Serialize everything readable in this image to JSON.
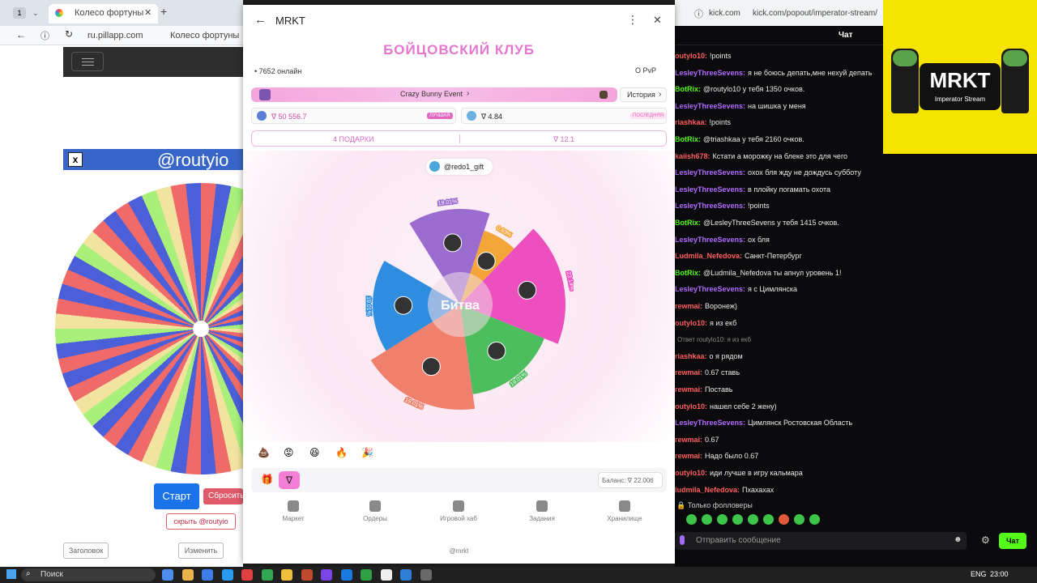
{
  "left_browser": {
    "tab_count": "1",
    "tab_title": "Колесо фортуны",
    "url": "ru.pillapp.com",
    "page_title": "Колесо фортуны",
    "wheel_header": "@routyio",
    "close_x": "x",
    "start_button": "Старт",
    "reset_button": "Сбросить",
    "hide_button": "скрыть @routyio",
    "heading_field": "Заголовок",
    "change_button": "Изменить"
  },
  "modal": {
    "back_icon": "arrow-left-icon",
    "app_name": "MRKT",
    "title": "БОЙЦОВСКИЙ КЛУБ",
    "online": "• 7652 онлайн",
    "pvp": "О PvP",
    "event": "Crazy Bunny Event",
    "history": "История",
    "best_value": "∇ 50 556.7",
    "best_badge": "ЛУЧШАЯ",
    "last_value": "∇ 4.84",
    "last_badge": "ПОСЛЕДНЯЯ",
    "gifts": "4 ПОДАРКИ",
    "pot": "∇ 12.1",
    "player": "@redo1_gift",
    "center": "Битва",
    "balance": "Баланс: ∇ 22.006",
    "footer": "@mrkt",
    "segments": [
      {
        "label": "19.01%",
        "color": "#9b6cd0"
      },
      {
        "label": "0.63%",
        "color": "#f3a637"
      },
      {
        "label": "23.14%",
        "color": "#ee4fbf"
      },
      {
        "label": "19.01%",
        "color": "#4cbe5d"
      },
      {
        "label": "19.01%",
        "color": "#f0806c"
      },
      {
        "label": "19.01%",
        "color": "#2f8de0"
      }
    ],
    "nav": [
      "Маркет",
      "Ордеры",
      "Игровой хаб",
      "Задания",
      "Хранилище"
    ]
  },
  "chat": {
    "url_host": "kick.com",
    "url_path": "kick.com/popout/imperator-stream/",
    "header": "Чат",
    "brand_logo": "MRKT",
    "brand_sub": "Imperator Stream",
    "followers_only": "Только фолловеры",
    "input_placeholder": "Отправить сообщение",
    "send": "Чат",
    "messages": [
      {
        "user": "outylo10:",
        "text": "!points",
        "color": "#ff5f5f"
      },
      {
        "user": "LesleyThreeSevens:",
        "text": "я не боюсь депать,мне нехуй депать",
        "color": "#b26bff"
      },
      {
        "user": "BotRix:",
        "text": "@routylo10 у тебя 1350 очков.",
        "color": "#53fc18"
      },
      {
        "user": "LesleyThreeSevens:",
        "text": "на шишка у меня",
        "color": "#b26bff"
      },
      {
        "user": "riashkaa:",
        "text": "!points",
        "color": "#ff5f5f"
      },
      {
        "user": "BotRix:",
        "text": "@triashkaa у тебя 2160 очков.",
        "color": "#53fc18"
      },
      {
        "user": "kaiish678:",
        "text": "Кстати а морожку на блеке это для чего",
        "color": "#ff5f5f"
      },
      {
        "user": "LesleyThreeSevens:",
        "text": "охох бля жду не дождусь субботу",
        "color": "#b26bff"
      },
      {
        "user": "LesleyThreeSevens:",
        "text": "в плойку погамать охота",
        "color": "#b26bff"
      },
      {
        "user": "LesleyThreeSevens:",
        "text": "!points",
        "color": "#b26bff"
      },
      {
        "user": "BotRix:",
        "text": "@LesleyThreeSevens у тебя 1415 очков.",
        "color": "#53fc18"
      },
      {
        "user": "LesleyThreeSevens:",
        "text": "ох бля",
        "color": "#b26bff"
      },
      {
        "user": "Ludmila_Nefedova:",
        "text": "Санкт-Петербург",
        "color": "#ff5f5f"
      },
      {
        "user": "BotRix:",
        "text": "@Ludmila_Nefedova ты апнул уровень 1!",
        "color": "#53fc18"
      },
      {
        "user": "LesleyThreeSevens:",
        "text": "я с Цимлянска",
        "color": "#b26bff"
      },
      {
        "user": "rewmai:",
        "text": "Воронеж)",
        "color": "#ff5f5f"
      },
      {
        "user": "outylo10:",
        "text": "я из екб",
        "color": "#ff5f5f"
      },
      {
        "user": "",
        "text": "Ответ routylo10: я из екб",
        "color": "#888888"
      },
      {
        "user": "riashkaa:",
        "text": "о я рядом",
        "color": "#ff5f5f"
      },
      {
        "user": "rewmai:",
        "text": "0.67 ставь",
        "color": "#ff5f5f"
      },
      {
        "user": "rewmai:",
        "text": "Поставь",
        "color": "#ff5f5f"
      },
      {
        "user": "outylo10:",
        "text": "нашел себе 2 жену)",
        "color": "#ff5f5f"
      },
      {
        "user": "LesleyThreeSevens:",
        "text": "Цимлянск Ростовская Область",
        "color": "#b26bff"
      },
      {
        "user": "rewmai:",
        "text": "0.67",
        "color": "#ff5f5f"
      },
      {
        "user": "rewmai:",
        "text": "Надо было 0.67",
        "color": "#ff5f5f"
      },
      {
        "user": "outylo10:",
        "text": "иди лучше в игру кальмара",
        "color": "#ff5f5f"
      },
      {
        "user": "ludmila_Nefedova:",
        "text": "Пхахахах",
        "color": "#ff5f5f"
      }
    ]
  },
  "taskbar": {
    "search": "Поиск",
    "lang": "ENG",
    "time": "23:00"
  }
}
